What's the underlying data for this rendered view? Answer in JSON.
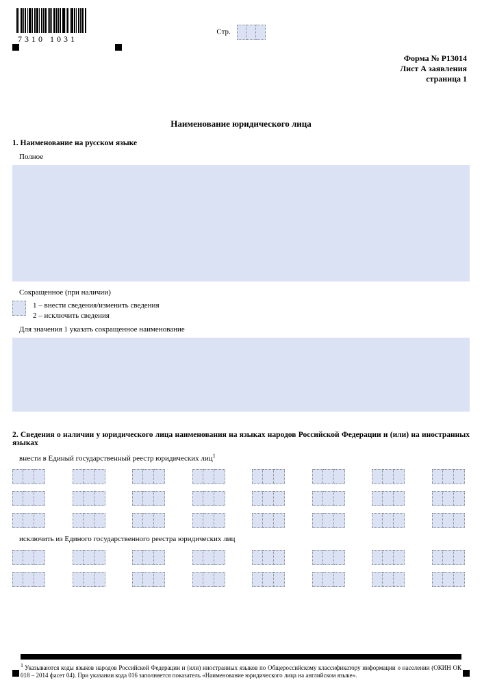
{
  "barcode_number": "7310 1031",
  "page_label": "Стр.",
  "header": {
    "form_no": "Форма № Р13014",
    "sheet": "Лист А заявления",
    "page": "страница 1"
  },
  "title": "Наименование юридического лица",
  "section1": {
    "heading": "1. Наименование на русском языке",
    "full_label": "Полное",
    "short_label": "Сокращенное (при наличии)",
    "option1": "1 – внести сведения/изменить сведения",
    "option2": "2 – исключить сведения",
    "instruction": "Для значения 1 указать сокращенное наименование"
  },
  "section2": {
    "heading": "2. Сведения о наличии у юридического лица наименования на языках народов Российской Федерации и (или) на иностранных языках",
    "add_label_prefix": "внести в Единый государственный реестр юридических лиц",
    "add_label_sup": "1",
    "remove_label": "исключить из Единого государственного реестра юридических лиц"
  },
  "footnote": {
    "num": "1",
    "text": "Указываются коды языков народов Российской Федерации и (или) иностранных языков по Общероссийскому классификатору информации о населении (ОКИН ОК 018 – 2014 фасет 04). При указании кода 016 заполняется показатель «Наименование юридического лица на английском языке»."
  }
}
